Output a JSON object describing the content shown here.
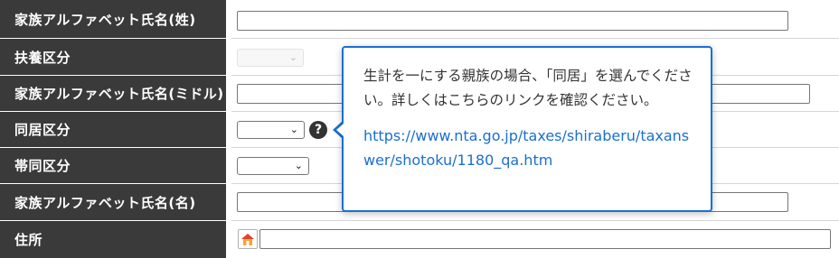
{
  "form": {
    "rows": [
      {
        "label": "家族アルファベット氏名(姓)",
        "field": "text"
      },
      {
        "label": "扶養区分",
        "field": "select-disabled",
        "value": ""
      },
      {
        "label": "家族アルファベット氏名(ミドル)",
        "field": "text"
      },
      {
        "label": "同居区分",
        "field": "select",
        "value": ""
      },
      {
        "label": "帯同区分",
        "field": "select",
        "value": ""
      },
      {
        "label": "家族アルファベット氏名(名)",
        "field": "text"
      },
      {
        "label": "住所",
        "field": "address"
      }
    ],
    "select_arrow_glyph": "⌄",
    "help_glyph": "?"
  },
  "tooltip": {
    "text": "生計を一にする親族の場合、「同居」を選んでください。詳しくはこちらのリンクを確認ください。",
    "link": "https://www.nta.go.jp/taxes/shiraberu/taxanswer/shotoku/1180_qa.htm",
    "border_color": "#1a6fd1"
  },
  "colors": {
    "label_bg": "#3a3a3a",
    "label_text": "#ffffff",
    "link": "#1a6fd1"
  },
  "icons": {
    "help": "question-circle-icon",
    "address": "house-icon",
    "select": "chevron-down-icon"
  }
}
